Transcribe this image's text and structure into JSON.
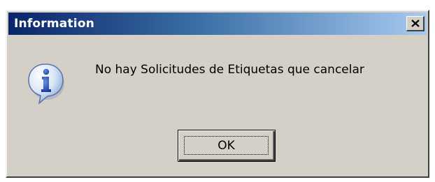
{
  "window": {
    "title": "Information",
    "close_icon": "close-icon"
  },
  "content": {
    "icon": "information-icon",
    "message": "No hay Solicitudes de Etiquetas que cancelar"
  },
  "buttons": {
    "ok_label": "OK"
  },
  "colors": {
    "titlebar_start": "#0a246a",
    "titlebar_end": "#a6caf0",
    "dialog_face": "#d4d0c8"
  }
}
